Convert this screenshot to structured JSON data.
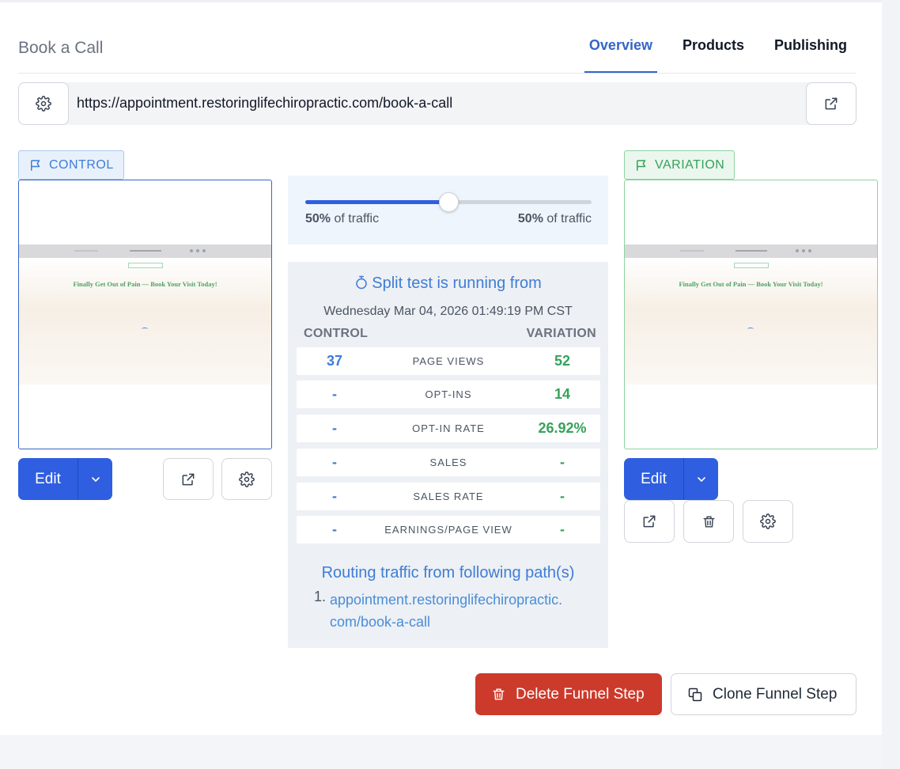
{
  "header": {
    "title": "Book a Call",
    "tabs": [
      {
        "label": "Overview",
        "active": true
      },
      {
        "label": "Products",
        "active": false
      },
      {
        "label": "Publishing",
        "active": false
      }
    ]
  },
  "url_bar": {
    "url": "https://appointment.restoringlifechiropractic.com/book-a-call"
  },
  "control": {
    "badge": "CONTROL",
    "preview_headline": "Finally Get Out of Pain — Book Your Visit Today!",
    "edit_label": "Edit"
  },
  "variation": {
    "badge": "VARIATION",
    "preview_headline": "Finally Get Out of Pain — Book Your Visit Today!",
    "edit_label": "Edit"
  },
  "traffic": {
    "control_percent": "50%",
    "variation_percent": "50%",
    "suffix": "of traffic",
    "split_fraction": 0.5
  },
  "split_test": {
    "status": "Split test is running from",
    "started": "Wednesday Mar 04, 2026 01:49:19 PM CST",
    "control_header": "CONTROL",
    "variation_header": "VARIATION",
    "metrics": [
      {
        "label": "PAGE VIEWS",
        "control": "37",
        "variation": "52"
      },
      {
        "label": "OPT-INS",
        "control": "-",
        "variation": "14"
      },
      {
        "label": "OPT-IN RATE",
        "control": "-",
        "variation": "26.92%"
      },
      {
        "label": "SALES",
        "control": "-",
        "variation": "-"
      },
      {
        "label": "SALES RATE",
        "control": "-",
        "variation": "-"
      },
      {
        "label": "EARNINGS/PAGE VIEW",
        "control": "-",
        "variation": "-"
      }
    ],
    "routing_title": "Routing traffic from following path(s)",
    "paths": [
      {
        "num": "1.",
        "line1": "appointment.restoringlifechiropractic.",
        "line2": "com/book-a-call"
      }
    ]
  },
  "actions": {
    "delete_label": "Delete Funnel Step",
    "clone_label": "Clone Funnel Step"
  },
  "colors": {
    "primary": "#2f5fe0",
    "control_accent": "#3e7dd6",
    "variation_accent": "#36a25a",
    "danger": "#cc3a2b"
  },
  "icons": [
    "gear-icon",
    "external-link-icon",
    "flag-icon",
    "chevron-down-icon",
    "trash-icon",
    "stopwatch-icon",
    "copy-icon"
  ]
}
